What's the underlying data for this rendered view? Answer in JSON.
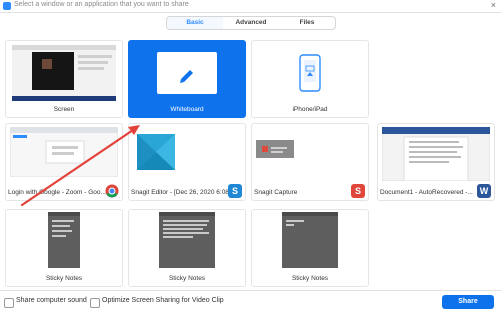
{
  "titlebar": {
    "title": "Select a window or an application that you want to share",
    "close_glyph": "×"
  },
  "tabs": [
    {
      "label": "Basic",
      "active": true
    },
    {
      "label": "Advanced",
      "active": false
    },
    {
      "label": "Files",
      "active": false
    }
  ],
  "tiles": {
    "screen": "Screen",
    "whiteboard": "Whiteboard",
    "iphone": "iPhone/iPad",
    "login_google": "Login with Google - Zoom - Goo...",
    "snagit_editor": "Snagit Editor - [Dec 26, 2020 6:08...",
    "snagit_capture": "Snagit Capture",
    "document1": "Document1 - AutoRecovered -...",
    "sticky1": "Sticky Notes",
    "sticky2": "Sticky Notes",
    "sticky3": "Sticky Notes"
  },
  "badges": {
    "snagit": "S",
    "word": "W"
  },
  "footer": {
    "share_sound": "Share computer sound",
    "optimize": "Optimize Screen Sharing for Video Clip",
    "share_button": "Share"
  },
  "colors": {
    "accent": "#0e72ed",
    "annotation_arrow": "#e3423a"
  }
}
